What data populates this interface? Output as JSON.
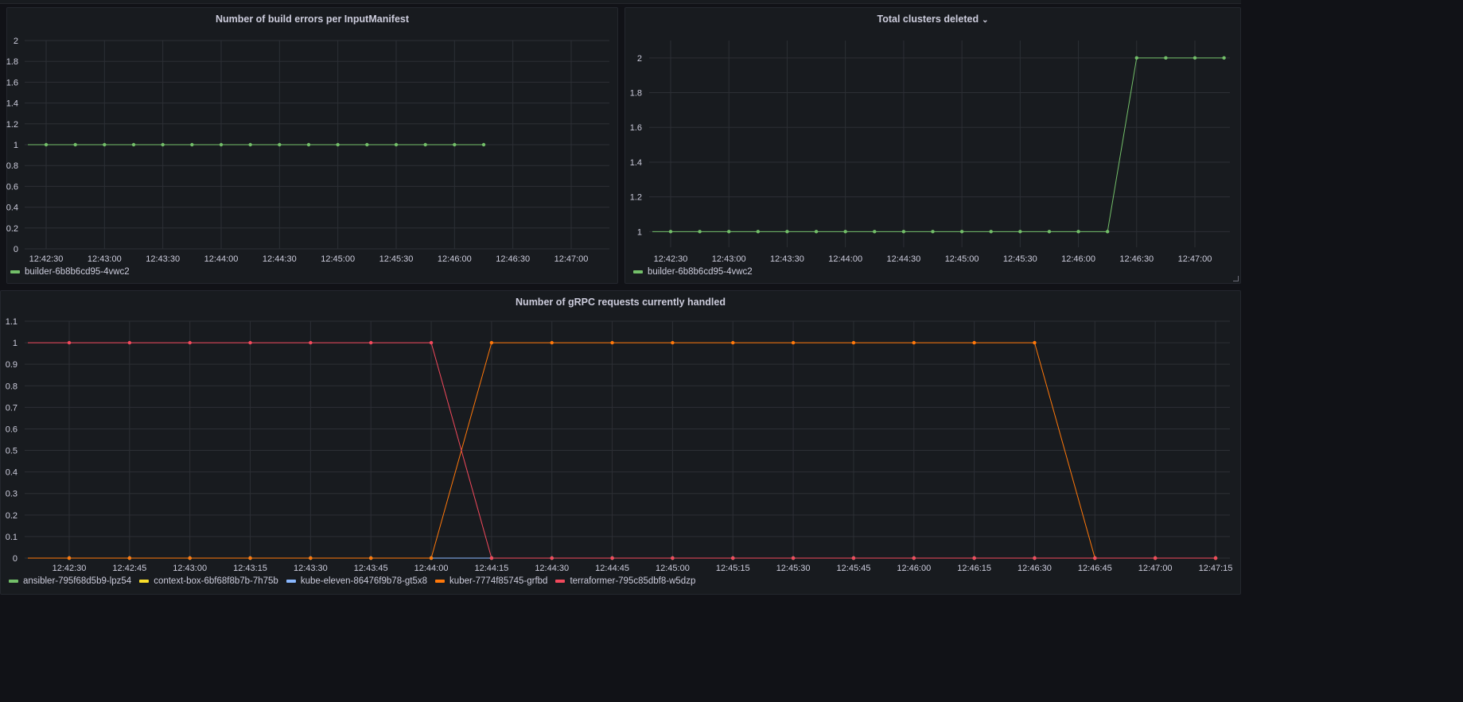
{
  "panels": [
    {
      "title": "Number of build errors per InputManifest",
      "chart_data": {
        "type": "line",
        "title": "Number of build errors per InputManifest",
        "x_ticks": [
          "12:42:30",
          "12:43:00",
          "12:43:30",
          "12:44:00",
          "12:44:30",
          "12:45:00",
          "12:45:30",
          "12:46:00",
          "12:46:30",
          "12:47:00"
        ],
        "y_ticks": [
          0,
          0.2,
          0.4,
          0.6,
          0.8,
          1,
          1.2,
          1.4,
          1.6,
          1.8,
          2
        ],
        "ylim": [
          0,
          2
        ],
        "x": [
          "12:42:30",
          "12:42:45",
          "12:43:00",
          "12:43:15",
          "12:43:30",
          "12:43:45",
          "12:44:00",
          "12:44:15",
          "12:44:30",
          "12:44:45",
          "12:45:00",
          "12:45:15",
          "12:45:30",
          "12:45:45",
          "12:46:00",
          "12:46:15"
        ],
        "series": [
          {
            "name": "builder-6b8b6cd95-4vwc2",
            "color": "#73bf69",
            "values": [
              1,
              1,
              1,
              1,
              1,
              1,
              1,
              1,
              1,
              1,
              1,
              1,
              1,
              1,
              1,
              1
            ]
          }
        ],
        "legend": "bottom-left",
        "grid": true
      }
    },
    {
      "title": "Total clusters deleted",
      "title_icon": "chevron-down-icon",
      "chart_data": {
        "type": "line",
        "title": "Total clusters deleted",
        "x_ticks": [
          "12:42:30",
          "12:43:00",
          "12:43:30",
          "12:44:00",
          "12:44:30",
          "12:45:00",
          "12:45:30",
          "12:46:00",
          "12:46:30",
          "12:47:00"
        ],
        "y_ticks": [
          1,
          1.2,
          1.4,
          1.6,
          1.8,
          2
        ],
        "ylim": [
          0.91,
          2.1
        ],
        "x": [
          "12:42:30",
          "12:42:45",
          "12:43:00",
          "12:43:15",
          "12:43:30",
          "12:43:45",
          "12:44:00",
          "12:44:15",
          "12:44:30",
          "12:44:45",
          "12:45:00",
          "12:45:15",
          "12:45:30",
          "12:45:45",
          "12:46:00",
          "12:46:15",
          "12:46:30",
          "12:46:45",
          "12:47:00",
          "12:47:15"
        ],
        "series": [
          {
            "name": "builder-6b8b6cd95-4vwc2",
            "color": "#73bf69",
            "values": [
              1,
              1,
              1,
              1,
              1,
              1,
              1,
              1,
              1,
              1,
              1,
              1,
              1,
              1,
              1,
              1,
              2,
              2,
              2,
              2
            ]
          }
        ],
        "legend": "bottom-left",
        "grid": true
      }
    },
    {
      "title": "Number of gRPC requests currently handled",
      "chart_data": {
        "type": "line",
        "title": "Number of gRPC requests currently handled",
        "x_ticks": [
          "12:42:30",
          "12:42:45",
          "12:43:00",
          "12:43:15",
          "12:43:30",
          "12:43:45",
          "12:44:00",
          "12:44:15",
          "12:44:30",
          "12:44:45",
          "12:45:00",
          "12:45:15",
          "12:45:30",
          "12:45:45",
          "12:46:00",
          "12:46:15",
          "12:46:30",
          "12:46:45",
          "12:47:00",
          "12:47:15"
        ],
        "y_ticks": [
          0,
          0.1,
          0.2,
          0.3,
          0.4,
          0.5,
          0.6,
          0.7,
          0.8,
          0.9,
          1,
          1.1
        ],
        "ylim": [
          0,
          1.1
        ],
        "x": [
          "12:42:30",
          "12:42:45",
          "12:43:00",
          "12:43:15",
          "12:43:30",
          "12:43:45",
          "12:44:00",
          "12:44:15",
          "12:44:30",
          "12:44:45",
          "12:45:00",
          "12:45:15",
          "12:45:30",
          "12:45:45",
          "12:46:00",
          "12:46:15",
          "12:46:30",
          "12:46:45",
          "12:47:00",
          "12:47:15"
        ],
        "series": [
          {
            "name": "ansibler-795f68d5b9-lpz54",
            "color": "#73bf69",
            "values": [
              0,
              0,
              0,
              0,
              0,
              0,
              0,
              0,
              0,
              0,
              0,
              0,
              0,
              0,
              0,
              0,
              0,
              0,
              0,
              0
            ]
          },
          {
            "name": "context-box-6bf68f8b7b-7h75b",
            "color": "#fade2a",
            "values": [
              0,
              0,
              0,
              0,
              0,
              0,
              0,
              0,
              0,
              0,
              0,
              0,
              0,
              0,
              0,
              0,
              0,
              0,
              0,
              0
            ]
          },
          {
            "name": "kube-eleven-86476f9b78-gt5x8",
            "color": "#8ab8ff",
            "values": [
              0,
              0,
              0,
              0,
              0,
              0,
              0,
              0,
              0,
              0,
              0,
              0,
              0,
              0,
              0,
              0,
              0,
              0,
              0,
              0
            ]
          },
          {
            "name": "kuber-7774f85745-grfbd",
            "color": "#ff780a",
            "values": [
              0,
              0,
              0,
              0,
              0,
              0,
              0,
              1,
              1,
              1,
              1,
              1,
              1,
              1,
              1,
              1,
              1,
              0,
              0,
              0
            ]
          },
          {
            "name": "terraformer-795c85dbf8-w5dzp",
            "color": "#f2495c",
            "values": [
              1,
              1,
              1,
              1,
              1,
              1,
              1,
              0,
              0,
              0,
              0,
              0,
              0,
              0,
              0,
              0,
              0,
              0,
              0,
              0
            ]
          }
        ],
        "legend": "bottom-left",
        "grid": true
      }
    }
  ]
}
